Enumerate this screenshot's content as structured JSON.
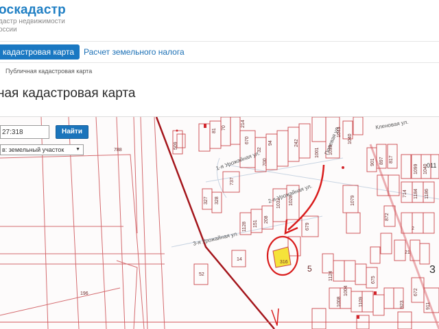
{
  "header": {
    "brand_title": "оскадастр",
    "brand_sub_1": "дастр недвижимости",
    "brand_sub_2": "оссии"
  },
  "nav": {
    "active_tab": "кадастровая карта",
    "tab_2": "Расчет земельного налога"
  },
  "breadcrumb": "Публичная кадастровая карта",
  "page_title": "ная кадастровая карта",
  "map": {
    "search_value": "27:318",
    "search_button": "Найти",
    "type_select": "в: земельный участок",
    "streets": [
      "1-я Урожайная ул.",
      "2-я Урожайная ул.",
      "3-я Урожайная ул.",
      "Кленовая ул.",
      "Полевая ул."
    ],
    "parcel_labels": [
      "788",
      "196",
      "509",
      "81",
      "70",
      "670",
      "214",
      "242",
      "94",
      "32",
      "327",
      "328",
      "737",
      "700",
      "1128",
      "151",
      "208",
      "1032",
      "1028",
      "1001",
      "1039",
      "1040",
      "1043",
      "679",
      "901",
      "1079",
      "897",
      "817",
      "1099",
      "1040",
      "714",
      "1184",
      "1186",
      "2",
      "21",
      "52",
      "14",
      "5",
      "3",
      "316",
      "1004",
      "1124",
      "1008",
      "1109",
      "672",
      "675",
      "872",
      "911",
      "923",
      "011"
    ],
    "selected_parcel": "316"
  },
  "colors": {
    "brand": "#1f7fc4",
    "nav_active": "#1a78c2",
    "button": "#1b74bb",
    "parcel_line": "#c9454a",
    "highlight": "#f5e33a",
    "annotation": "#d91c1c"
  }
}
